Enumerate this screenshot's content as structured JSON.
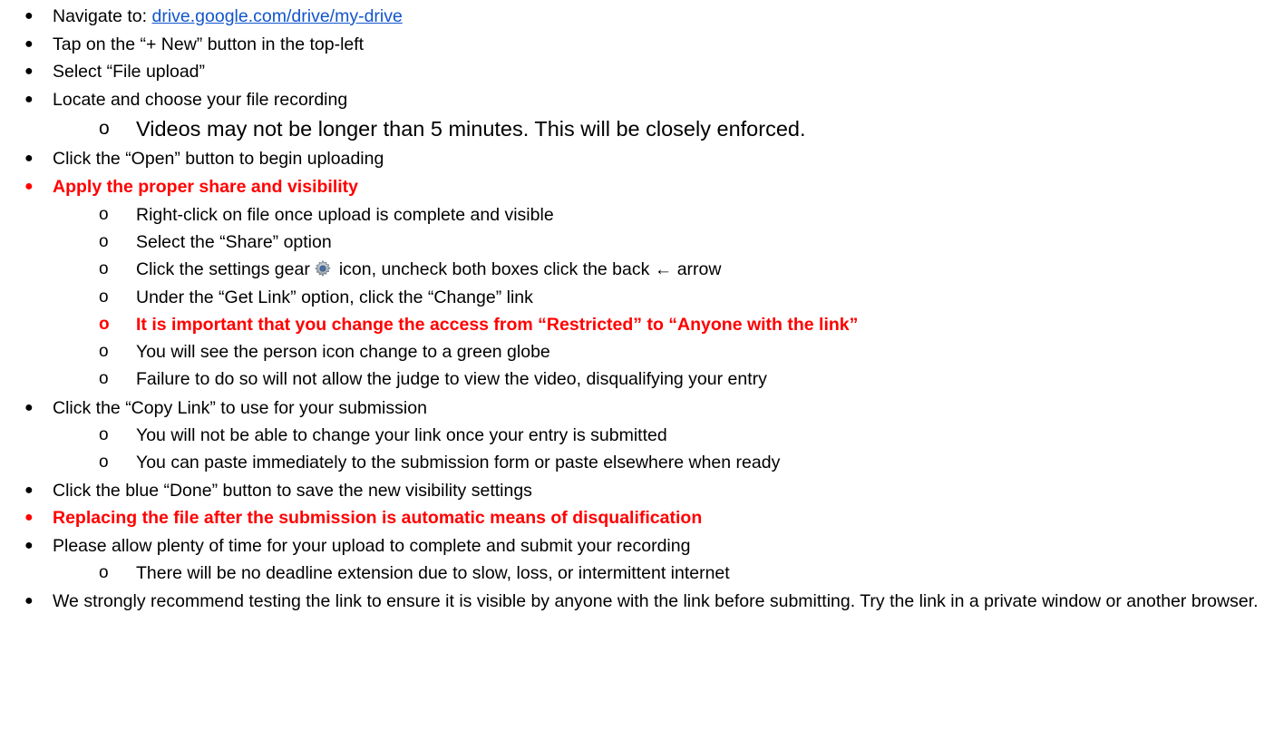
{
  "items": [
    {
      "prefix": "Navigate to: ",
      "link": "drive.google.com/drive/my-drive"
    },
    {
      "text": "Tap on the “+ New” button in the top-left"
    },
    {
      "text": "Select “File upload”"
    },
    {
      "text": "Locate and choose your file recording"
    },
    {
      "text": "Videos may not be longer than 5 minutes.  This will be closely enforced."
    },
    {
      "text": "Click the “Open” button to begin uploading"
    },
    {
      "text": "Apply the proper share and visibility"
    },
    {
      "text": "Right-click on file once upload is complete and visible"
    },
    {
      "text": "Select the “Share” option"
    },
    {
      "pre": "Click the settings gear",
      "post": "icon, uncheck both boxes click the back ← arrow"
    },
    {
      "text": "Under the “Get Link” option, click the “Change” link"
    },
    {
      "text": "It is important that you change the access from “Restricted” to “Anyone with the link”"
    },
    {
      "text": "You will see the person icon change to a green globe"
    },
    {
      "text": "Failure to do so will not allow the judge to view the video, disqualifying your entry"
    },
    {
      "text": "Click the “Copy Link” to use for your submission"
    },
    {
      "text": "You will not be able to change your link once your entry is submitted"
    },
    {
      "text": "You can paste immediately to the submission form or paste elsewhere when ready"
    },
    {
      "text": "Click the blue “Done” button to save the new visibility settings"
    },
    {
      "text": "Replacing the file after the submission is automatic means of disqualification"
    },
    {
      "text": "Please allow plenty of time for your upload to complete and submit your recording"
    },
    {
      "text": "There will be no deadline extension due to slow, loss, or intermittent internet"
    },
    {
      "text": "We strongly recommend testing the link to ensure it is visible by anyone with the link before submitting. Try the link in a private window or another browser."
    }
  ],
  "bullets": {
    "level1": "●",
    "level2": "o"
  },
  "colors": {
    "text": "#000000",
    "emphasis": "#ff0000",
    "link": "#1155cc"
  },
  "icons": {
    "settings": "gear-icon"
  }
}
